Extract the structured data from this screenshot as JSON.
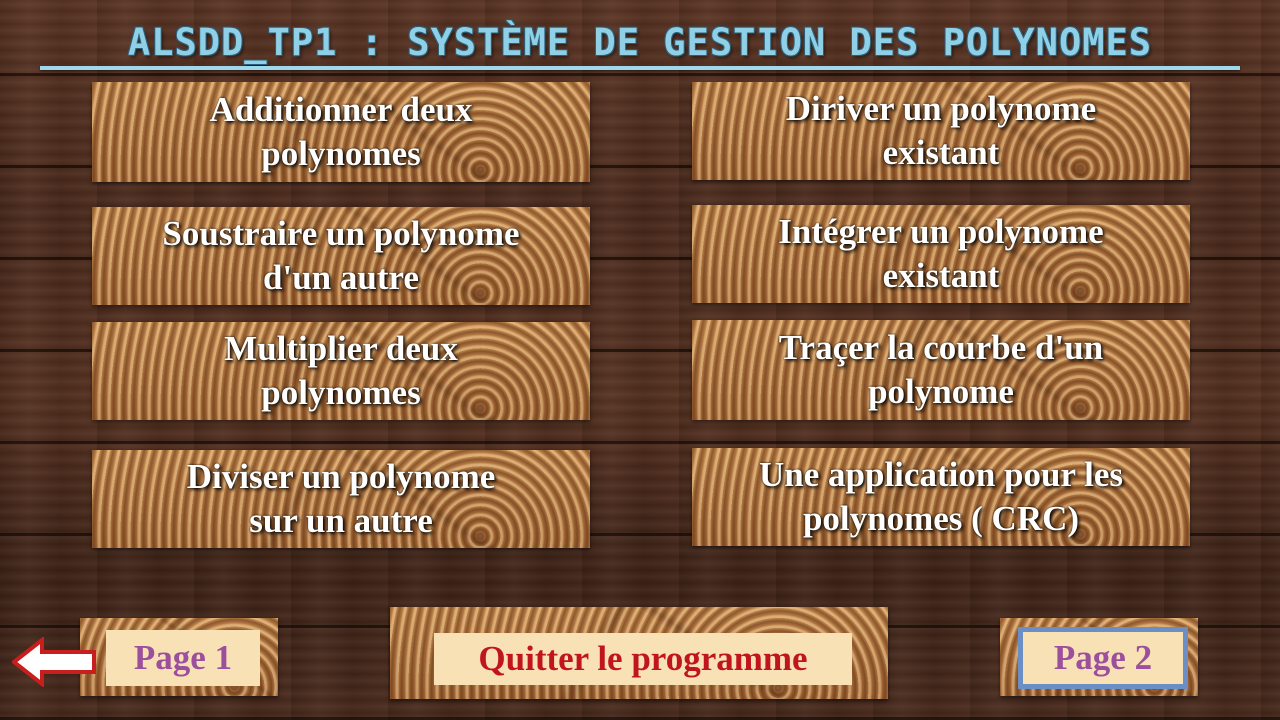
{
  "title": "ALSDD_TP1 : SYSTÈME DE GESTION DES POLYNOMES",
  "menu": {
    "add": [
      "Additionner deux",
      "polynomes"
    ],
    "derive": [
      "Diriver un polynome",
      "existant"
    ],
    "subtract": [
      "Soustraire un polynome",
      "d'un autre"
    ],
    "integrate": [
      "Intégrer un polynome",
      "existant"
    ],
    "multiply": [
      "Multiplier deux",
      "polynomes"
    ],
    "plot": [
      "Traçer la courbe d'un",
      "polynome"
    ],
    "divide": [
      "Diviser un polynome",
      "sur un autre"
    ],
    "crc": [
      "Une application pour les",
      "polynomes ( CRC)"
    ]
  },
  "footer": {
    "page1": "Page 1",
    "quit": "Quitter le programme",
    "page2": "Page 2"
  },
  "icons": {
    "back": "left-arrow-icon"
  },
  "colors": {
    "title": "#8fd0e6",
    "page_label": "#9c4f9c",
    "quit_label": "#c0151c",
    "page2_border": "#6b8fc4"
  }
}
